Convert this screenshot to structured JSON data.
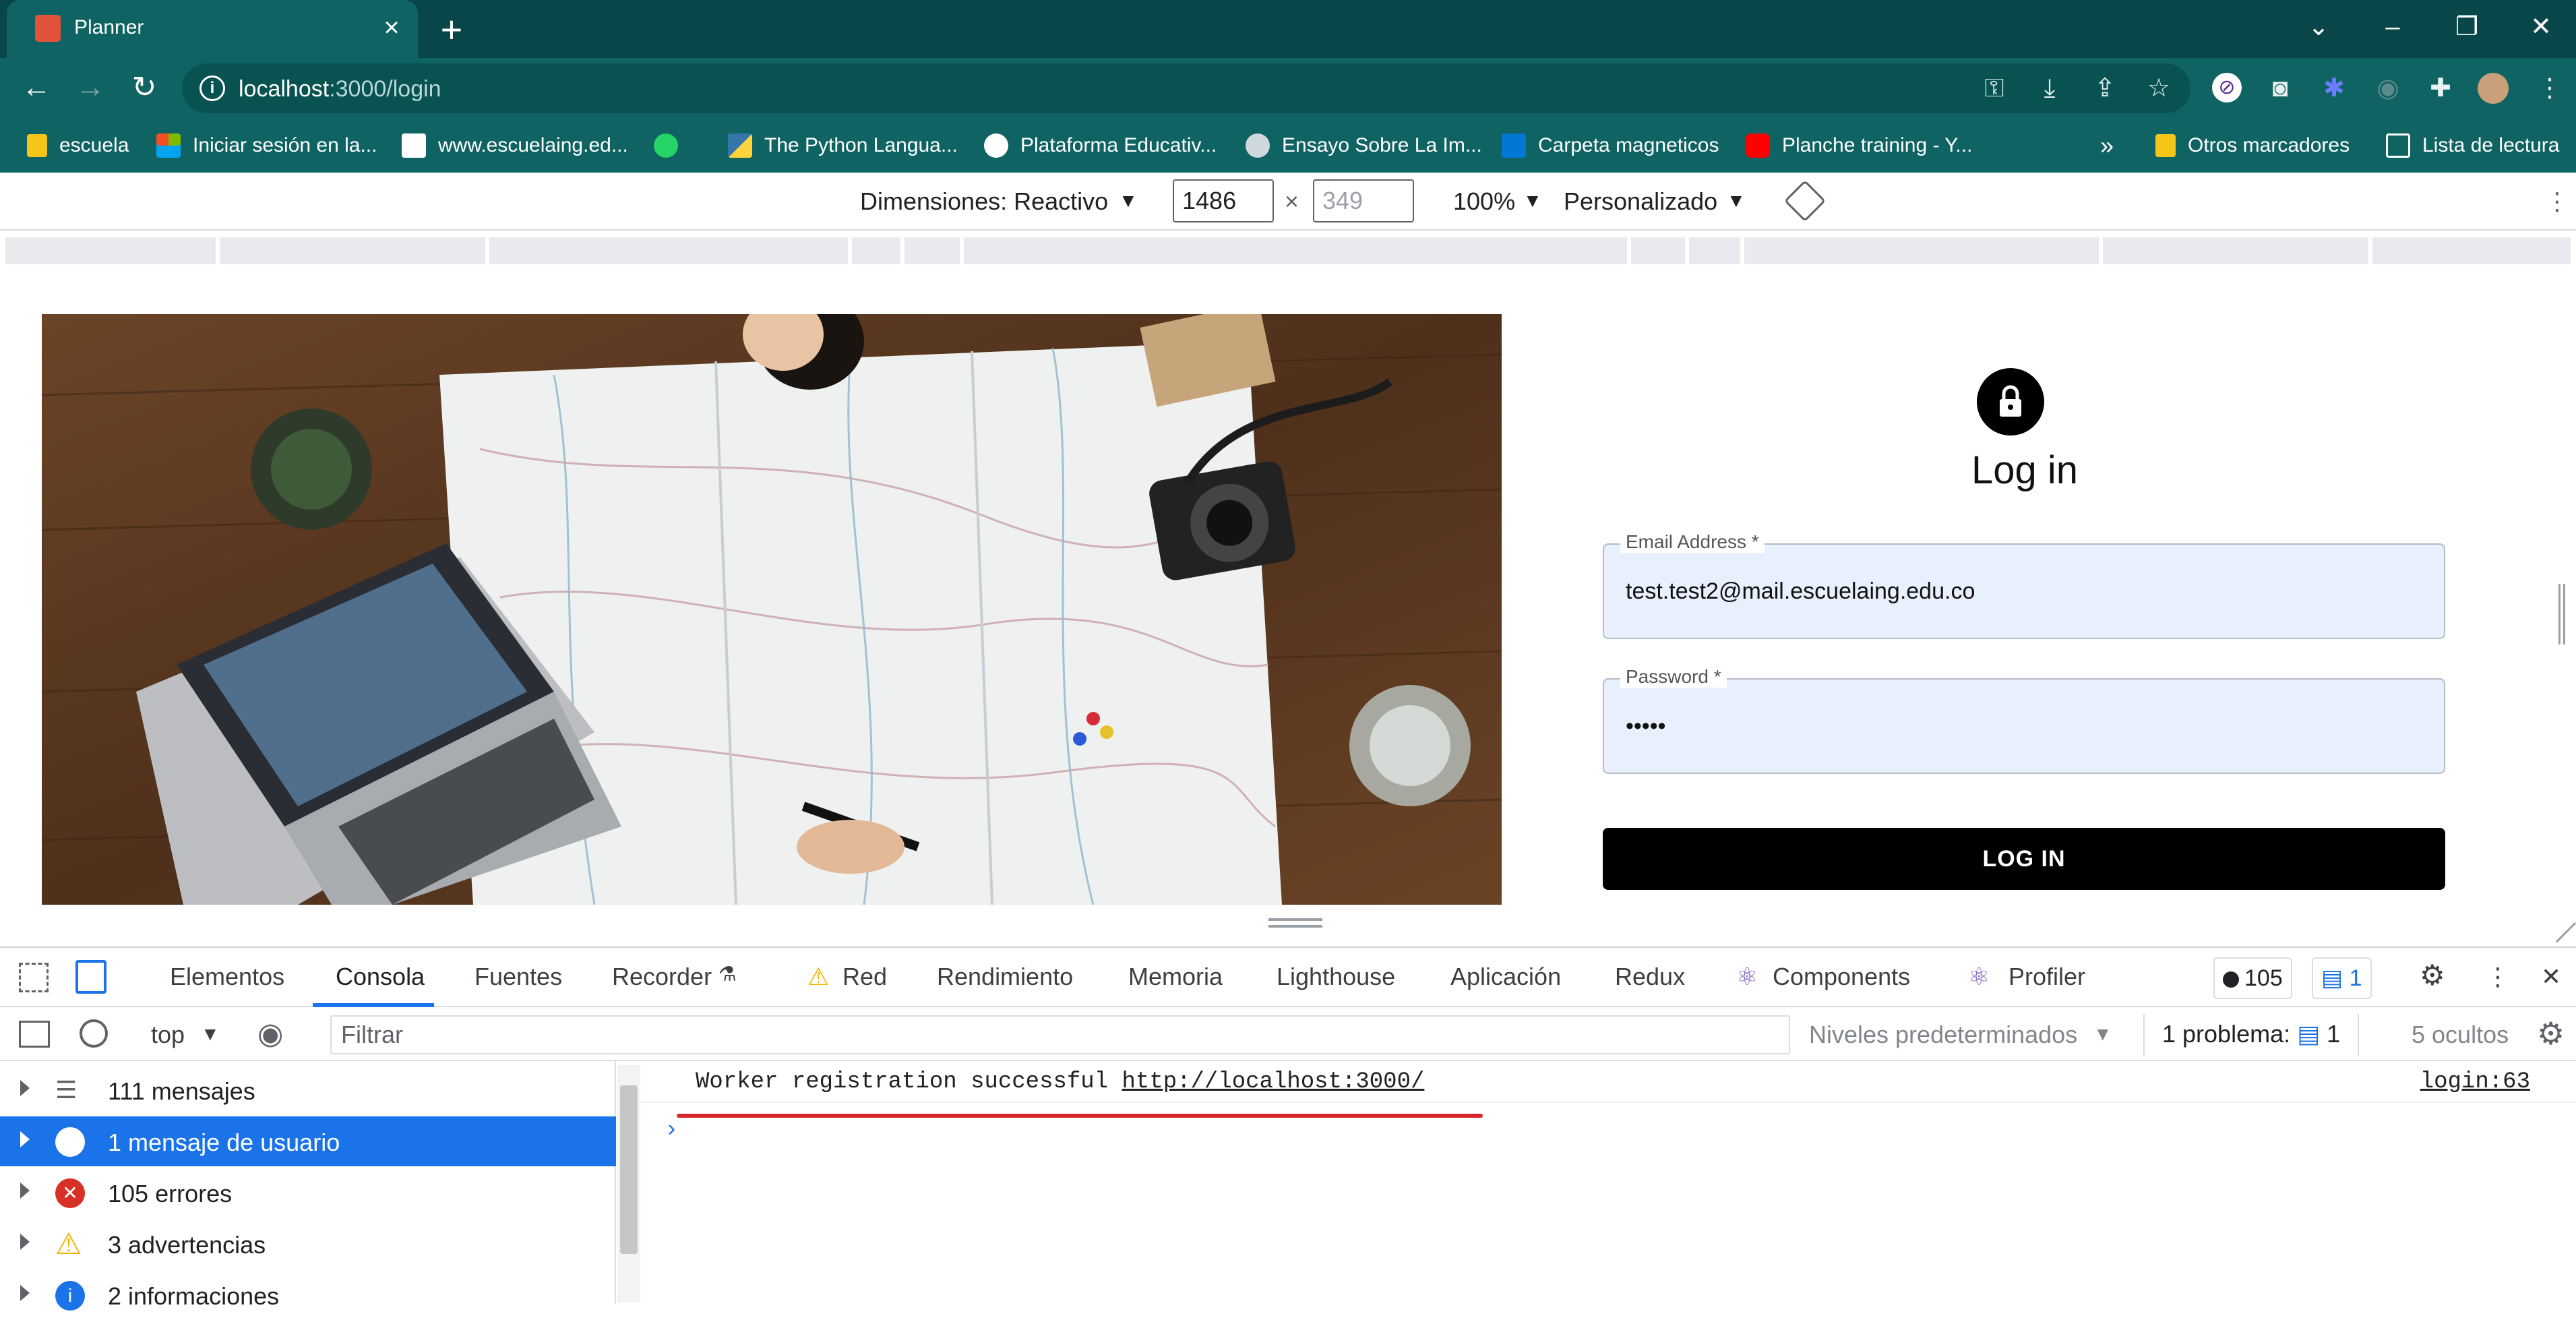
{
  "browser": {
    "tab_title": "Planner",
    "url_host": "localhost",
    "url_path": ":3000/login",
    "window_controls": [
      "chevron-down",
      "minimize",
      "restore",
      "close"
    ]
  },
  "bookmarks": [
    {
      "label": "escuela",
      "icon": "folder-icon"
    },
    {
      "label": "Iniciar sesión en la...",
      "icon": "microsoft-icon"
    },
    {
      "label": "www.escuelaing.ed...",
      "icon": "page-icon"
    },
    {
      "label": "",
      "icon": "whatsapp-icon"
    },
    {
      "label": "The Python Langua...",
      "icon": "python-icon"
    },
    {
      "label": "Plataforma Educativ...",
      "icon": "globe-icon"
    },
    {
      "label": "Ensayo Sobre La Im...",
      "icon": "s-icon"
    },
    {
      "label": "Carpeta magneticos",
      "icon": "outlook-icon"
    },
    {
      "label": "Planche training - Y...",
      "icon": "youtube-icon"
    },
    {
      "label": "»",
      "icon": ""
    },
    {
      "label": "Otros marcadores",
      "icon": "folder-icon"
    },
    {
      "label": "Lista de lectura",
      "icon": "reading-list-icon"
    }
  ],
  "device_toolbar": {
    "dimensions_label": "Dimensiones: Reactivo",
    "width": "1486",
    "height": "349",
    "zoom": "100%",
    "throttle": "Personalizado"
  },
  "page": {
    "login_title": "Log in",
    "email_label": "Email Address *",
    "email_value": "test.test2@mail.escuelaing.edu.co",
    "password_label": "Password *",
    "password_value": "•••••",
    "login_button": "LOG IN"
  },
  "devtools": {
    "tabs": [
      "Elementos",
      "Consola",
      "Fuentes",
      "Recorder",
      "Red",
      "Rendimiento",
      "Memoria",
      "Lighthouse",
      "Aplicación",
      "Redux",
      "Components",
      "Profiler"
    ],
    "active_tab": "Consola",
    "error_count": "105",
    "issue_count": "1",
    "context": "top",
    "filter_placeholder": "Filtrar",
    "levels": "Niveles predeterminados",
    "problems_label": "1 problema:",
    "problems_count": "1",
    "hidden": "5 ocultos",
    "sidebar": [
      {
        "label": "111 mensajes",
        "icon": "list-icon"
      },
      {
        "label": "1 mensaje de usuario",
        "icon": "user-icon"
      },
      {
        "label": "105 errores",
        "icon": "error-icon"
      },
      {
        "label": "3 advertencias",
        "icon": "warning-icon"
      },
      {
        "label": "2 informaciones",
        "icon": "info-icon"
      }
    ],
    "log": {
      "message": "Worker registration successful ",
      "link": "http://localhost:3000/",
      "source": "login:63"
    }
  }
}
